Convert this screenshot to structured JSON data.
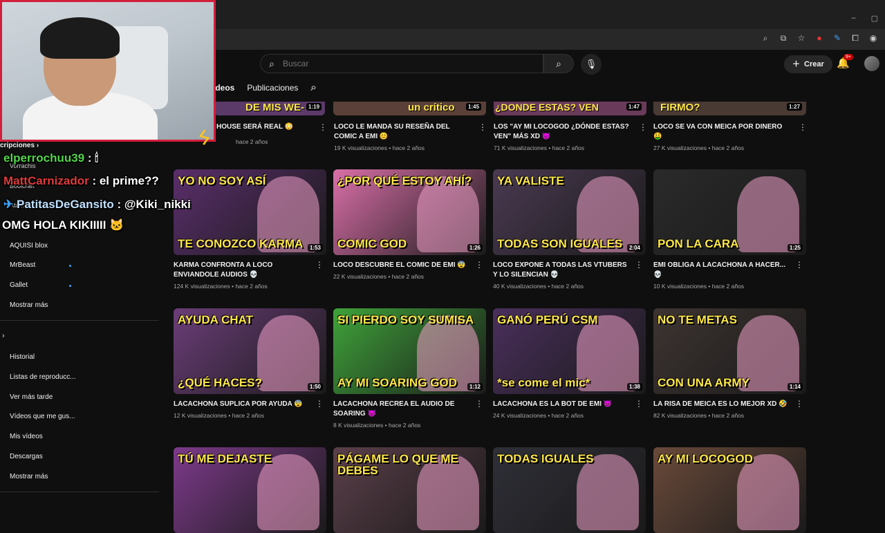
{
  "browser": {
    "window_controls": [
      "–",
      "▢"
    ]
  },
  "header": {
    "search": {
      "placeholder": "Buscar"
    },
    "create_label": "Crear",
    "notif_badge": "9+"
  },
  "channel_tabs": [
    {
      "label": "Vídeos",
      "active": true
    },
    {
      "label": "Publicaciones",
      "active": false
    }
  ],
  "sidebar": {
    "subs_header": "cripciones",
    "subscriptions": [
      {
        "label": "Vorrachis"
      },
      {
        "label": "Boolcraft"
      },
      {
        "label": "Atamonta"
      },
      {
        "label": "AQUISI blox"
      },
      {
        "label": "MrBeast",
        "new": true
      },
      {
        "label": "Gallet",
        "new": true
      },
      {
        "label": "Mostrar más"
      }
    ],
    "you_items": [
      {
        "label": "Historial"
      },
      {
        "label": "Listas de reproducc..."
      },
      {
        "label": "Ver más tarde"
      },
      {
        "label": "Vídeos que me gus..."
      },
      {
        "label": "Mis vídeos"
      },
      {
        "label": "Descargas"
      },
      {
        "label": "Mostrar más"
      }
    ]
  },
  "chat": [
    {
      "user": "elperrochuu39",
      "text": ": 🕯"
    },
    {
      "user": "MattCarnizador",
      "text": ": el prime??"
    },
    {
      "user": "PatitasDeGansito",
      "text": ": @Kiki_nikki"
    },
    {
      "user": "",
      "text": "OMG HOLA KIKIIIII 🐱"
    }
  ],
  "videos_top": [
    {
      "title": "HOUSE SERÁ REAL 😳",
      "meta": "hace 2 años",
      "dur": "1:19",
      "cap": "DE MIS WE-"
    },
    {
      "title": "LOCO LE MANDA SU RESEÑA DEL COMIC A EMI 😊",
      "meta": "19 K visualizaciones • hace 2 años",
      "dur": "1:45",
      "cap": "un crítico"
    },
    {
      "title": "LOS \"AY MI LOCOGOD ¿DÓNDE ESTAS? VEN\" MÁS XD 👿",
      "meta": "71 K visualizaciones • hace 2 años",
      "dur": "1:47",
      "cap": "¿DONDE ESTAS? VEN"
    },
    {
      "title": "LOCO SE VA CON MEICA POR DINERO 🤑",
      "meta": "27 K visualizaciones • hace 2 años",
      "dur": "1:27",
      "cap": "FIRMO?"
    }
  ],
  "videos": [
    {
      "title": "KARMA CONFRONTA A LOCO ENVIANDOLE AUDIOS 💀",
      "meta": "124 K visualizaciones • hace 2 años",
      "dur": "1:53",
      "cap1": "YO NO SOY ASÍ",
      "cap2": "TE CONOZCO KARMA",
      "bg": "#5a2e6b"
    },
    {
      "title": "LOCO DESCUBRE EL COMIC DE EMI 😨",
      "meta": "22 K visualizaciones • hace 2 años",
      "dur": "1:26",
      "cap1": "¿POR QUÉ ESTOY AHÍ?",
      "cap2": "COMIC GOD",
      "bg": "#d96fa8"
    },
    {
      "title": "LOCO EXPONE A TODAS LAS VTUBERS Y LO SILENCIAN 💀",
      "meta": "40 K visualizaciones • hace 2 años",
      "dur": "2:04",
      "cap1": "YA VALISTE",
      "cap2": "TODAS SON IGUALES",
      "bg": "#4a3a52"
    },
    {
      "title": "EMI OBLIGA A LACACHONA A HACER... 💀",
      "meta": "10 K visualizaciones • hace 2 años",
      "dur": "1:25",
      "cap1": "",
      "cap2": "PON LA CARA",
      "bg": "#2a2a2a"
    },
    {
      "title": "LACACHONA SUPLICA POR AYUDA 😨",
      "meta": "12 K visualizaciones • hace 2 años",
      "dur": "1:50",
      "cap1": "AYUDA CHAT",
      "cap2": "¿QUÉ HACES?",
      "bg": "#6b3d78"
    },
    {
      "title": "LACACHONA RECREA EL AUDIO DE SOARING 👿",
      "meta": "8 K visualizaciones • hace 2 años",
      "dur": "1:12",
      "cap1": "SI PIERDO SOY SUMISA",
      "cap2": "AY MI SOARING GOD",
      "bg": "#3fa33a"
    },
    {
      "title": "LACACHONA ES LA BOT DE EMI 👿",
      "meta": "24 K visualizaciones • hace 2 años",
      "dur": "1:38",
      "cap1": "GANÓ PERÚ CSM",
      "cap2": "*se come el mic*",
      "bg": "#4a2f5c"
    },
    {
      "title": "LA RISA DE MEICA ES LO MEJOR XD 🤣",
      "meta": "82 K visualizaciones • hace 2 años",
      "dur": "1:14",
      "cap1": "NO TE METAS",
      "cap2": "CON UNA ARMY",
      "bg": "#3d3431"
    },
    {
      "title": "",
      "meta": "",
      "dur": "",
      "cap1": "TÚ ME DEJASTE",
      "cap2": "",
      "bg": "#7d3a8a"
    },
    {
      "title": "",
      "meta": "",
      "dur": "",
      "cap1": "PÁGAME LO QUE ME DEBES",
      "cap2": "",
      "bg": "#5b3f4a"
    },
    {
      "title": "",
      "meta": "",
      "dur": "",
      "cap1": "TODAS IGUALES",
      "cap2": "",
      "bg": "#2f2f38"
    },
    {
      "title": "",
      "meta": "",
      "dur": "",
      "cap1": "AY MI LOCOGOD",
      "cap2": "",
      "bg": "#6a4a3a"
    }
  ],
  "colors": {
    "bg": "#0f0f0f",
    "accent_red": "#d31e3b",
    "caption_yellow": "#ffe74a"
  }
}
